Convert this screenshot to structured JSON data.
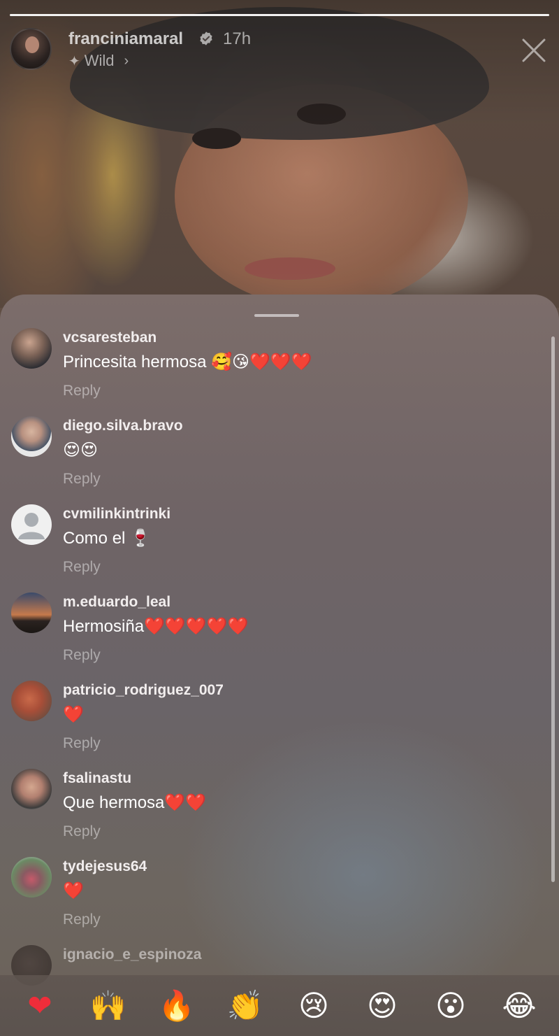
{
  "story": {
    "username": "franciniamaral",
    "verified": true,
    "time": "17h",
    "music_label": "Wild",
    "progress": 1.0
  },
  "comments": [
    {
      "username": "vcsaresteban",
      "text": "Princesita hermosa 🥰😘❤️❤️❤️",
      "reply_label": "Reply",
      "avatar": "av-1"
    },
    {
      "username": "diego.silva.bravo",
      "text": "😍😍",
      "reply_label": "Reply",
      "avatar": "av-2"
    },
    {
      "username": "cvmilinkintrinki",
      "text": "Como el 🍷",
      "reply_label": "Reply",
      "avatar": "av-3"
    },
    {
      "username": "m.eduardo_leal",
      "text": "Hermosiña❤️❤️❤️❤️❤️",
      "reply_label": "Reply",
      "avatar": "av-4"
    },
    {
      "username": "patricio_rodriguez_007",
      "text": "❤️",
      "reply_label": "Reply",
      "avatar": "av-5"
    },
    {
      "username": "fsalinastu",
      "text": "Que hermosa❤️❤️",
      "reply_label": "Reply",
      "avatar": "av-6"
    },
    {
      "username": "tydejesus64",
      "text": "❤️",
      "reply_label": "Reply",
      "avatar": "av-7"
    },
    {
      "username": "ignacio_e_espinoza",
      "text": "",
      "reply_label": "",
      "avatar": "av-8"
    }
  ],
  "reactions": [
    {
      "name": "heart",
      "glyph": "❤"
    },
    {
      "name": "raising-hands",
      "glyph": "🙌"
    },
    {
      "name": "fire",
      "glyph": "🔥"
    },
    {
      "name": "clapping-hands",
      "glyph": "👏"
    },
    {
      "name": "crying-face",
      "glyph": "😢"
    },
    {
      "name": "heart-eyes",
      "glyph": "😍"
    },
    {
      "name": "surprised-face",
      "glyph": "😮"
    },
    {
      "name": "tears-of-joy",
      "glyph": "😂"
    }
  ],
  "colors": {
    "heart": "#ef2d3a",
    "sheet_bg": "#6f6466",
    "reply_text": "rgba(255,255,255,0.45)"
  }
}
